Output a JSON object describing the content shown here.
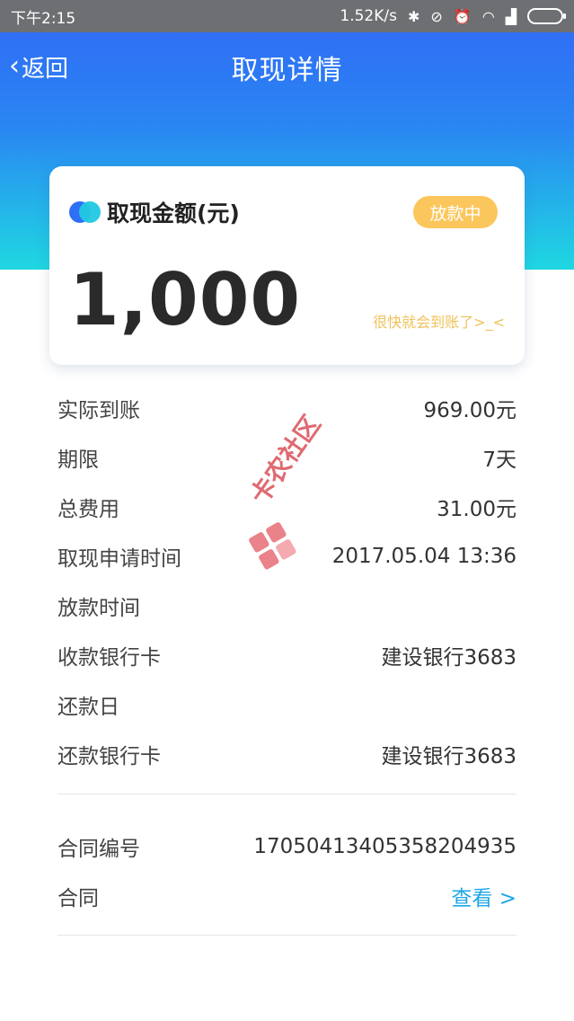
{
  "status_bar": {
    "time": "下午2:15",
    "speed": "1.52K/s",
    "icons": [
      "bluetooth-icon",
      "mute-icon",
      "alarm-icon",
      "wifi-icon",
      "signal-icon",
      "battery-icon"
    ]
  },
  "nav": {
    "back_label": "返回",
    "title": "取现详情"
  },
  "card": {
    "label": "取现金额(元)",
    "status_badge": "放款中",
    "amount": "1,000",
    "hint": "很快就会到账了>_<"
  },
  "details": [
    {
      "label": "实际到账",
      "value": "969.00元"
    },
    {
      "label": "期限",
      "value": "7天"
    },
    {
      "label": "总费用",
      "value": "31.00元"
    },
    {
      "label": "取现申请时间",
      "value": "2017.05.04 13:36"
    },
    {
      "label": "放款时间",
      "value": ""
    },
    {
      "label": "收款银行卡",
      "value": "建设银行3683"
    },
    {
      "label": "还款日",
      "value": ""
    },
    {
      "label": "还款银行卡",
      "value": "建设银行3683"
    }
  ],
  "contract": {
    "number_label": "合同编号",
    "number_value": "17050413405358204935",
    "contract_label": "合同",
    "view_link": "查看 >"
  },
  "watermark": {
    "text": "卡农社区"
  },
  "colors": {
    "header_top": "#2f6ff5",
    "header_bottom": "#1fd7e1",
    "badge": "#fbc65b",
    "hint": "#f1c15a",
    "link": "#1ea7e8",
    "status_bar": "#6d6f73"
  }
}
